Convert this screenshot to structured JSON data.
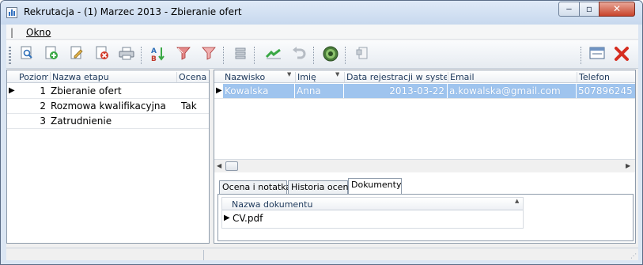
{
  "window": {
    "title": "Rekrutacja - (1) Marzec 2013 - Zbieranie ofert",
    "minimize_glyph": "‒",
    "maximize_glyph": "▫",
    "close_glyph": "✕"
  },
  "menu": {
    "grip": "|",
    "items": [
      "Okno"
    ]
  },
  "toolbar": {
    "icons": [
      "preview-icon",
      "add-icon",
      "edit-icon",
      "delete-icon",
      "print-icon",
      "sort-az-icon",
      "filter-icon",
      "clear-filter-icon",
      "list-icon",
      "approve-icon",
      "undo-icon",
      "target-icon",
      "attach-icon",
      "window-icon",
      "close-icon"
    ]
  },
  "stages": {
    "headers": {
      "level": "Poziom",
      "name": "Nazwa etapu",
      "rating": "Ocena ."
    },
    "rows": [
      {
        "level": "1",
        "name": "Zbieranie ofert",
        "rating": "",
        "current": true
      },
      {
        "level": "2",
        "name": "Rozmowa kwalifikacyjna",
        "rating": "Tak",
        "current": false
      },
      {
        "level": "3",
        "name": "Zatrudnienie",
        "rating": "",
        "current": false
      }
    ]
  },
  "candidates": {
    "headers": {
      "surname": "Nazwisko",
      "first_name": "Imię",
      "registered": "Data rejestracji w systemie",
      "email": "Email",
      "phone": "Telefon"
    },
    "rows": [
      {
        "surname": "Kowalska",
        "first_name": "Anna",
        "registered": "2013-03-22",
        "email": "a.kowalska@gmail.com",
        "phone": "507896245",
        "selected": true
      }
    ]
  },
  "tabs": [
    {
      "label": "Ocena i notatka",
      "active": false
    },
    {
      "label": "Historia ocen",
      "active": false
    },
    {
      "label": "Dokumenty",
      "active": true
    }
  ],
  "documents": {
    "header": "Nazwa dokumentu",
    "rows": [
      {
        "name": "CV.pdf"
      }
    ]
  },
  "colors": {
    "selection": "#9fc4ee",
    "window_frame": "#dbe6f3",
    "close_button": "#c8432b"
  }
}
